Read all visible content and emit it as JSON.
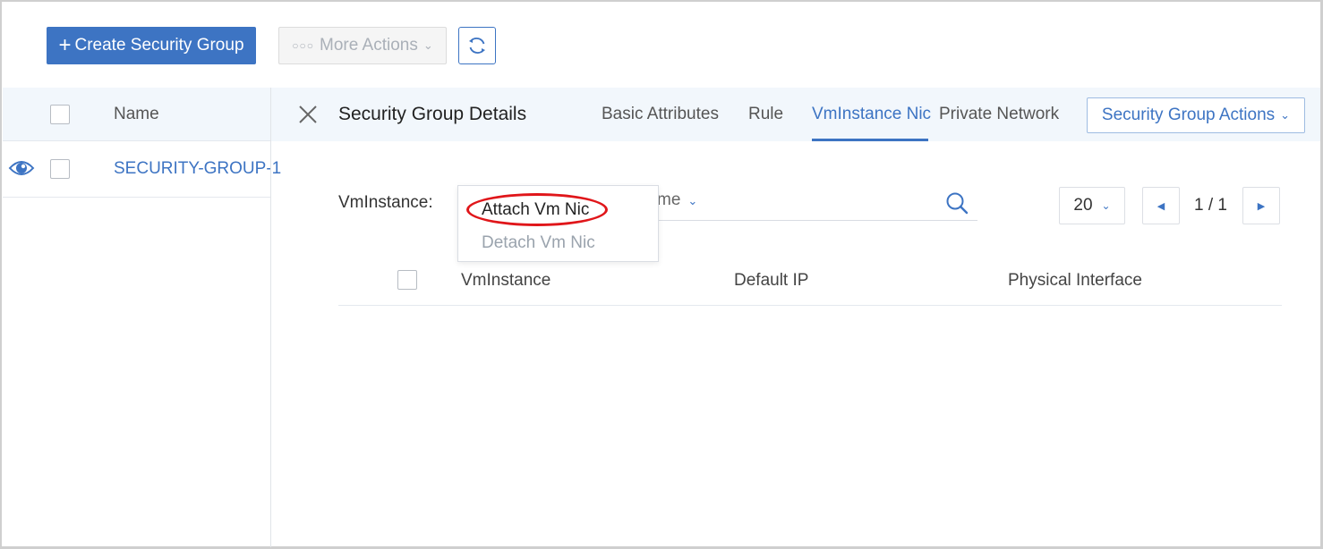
{
  "toolbar": {
    "create_label": "Create Security Group",
    "more_actions_label": "More Actions",
    "refresh_icon": "refresh-icon"
  },
  "list": {
    "column_name": "Name",
    "rows": [
      {
        "name": "SECURITY-GROUP-1"
      }
    ]
  },
  "details": {
    "title": "Security Group Details",
    "tabs": [
      {
        "label": "Basic Attributes",
        "active": false
      },
      {
        "label": "Rule",
        "active": false
      },
      {
        "label": "VmInstance Nic",
        "active": true
      },
      {
        "label": "Private Network",
        "active": false
      }
    ],
    "actions_label": "Security Group Actions"
  },
  "filter": {
    "label": "VmInstance:",
    "field_partial": "me"
  },
  "pagination": {
    "page_size": "20",
    "page_text": "1 / 1"
  },
  "menu": {
    "items": [
      {
        "label": "Attach Vm Nic",
        "enabled": true
      },
      {
        "label": "Detach Vm Nic",
        "enabled": false
      }
    ]
  },
  "table": {
    "columns": [
      "VmInstance",
      "Default IP",
      "Physical Interface"
    ]
  },
  "colors": {
    "primary": "#3d74c3",
    "highlight": "#e0161a",
    "header_bg": "#f2f7fc"
  }
}
